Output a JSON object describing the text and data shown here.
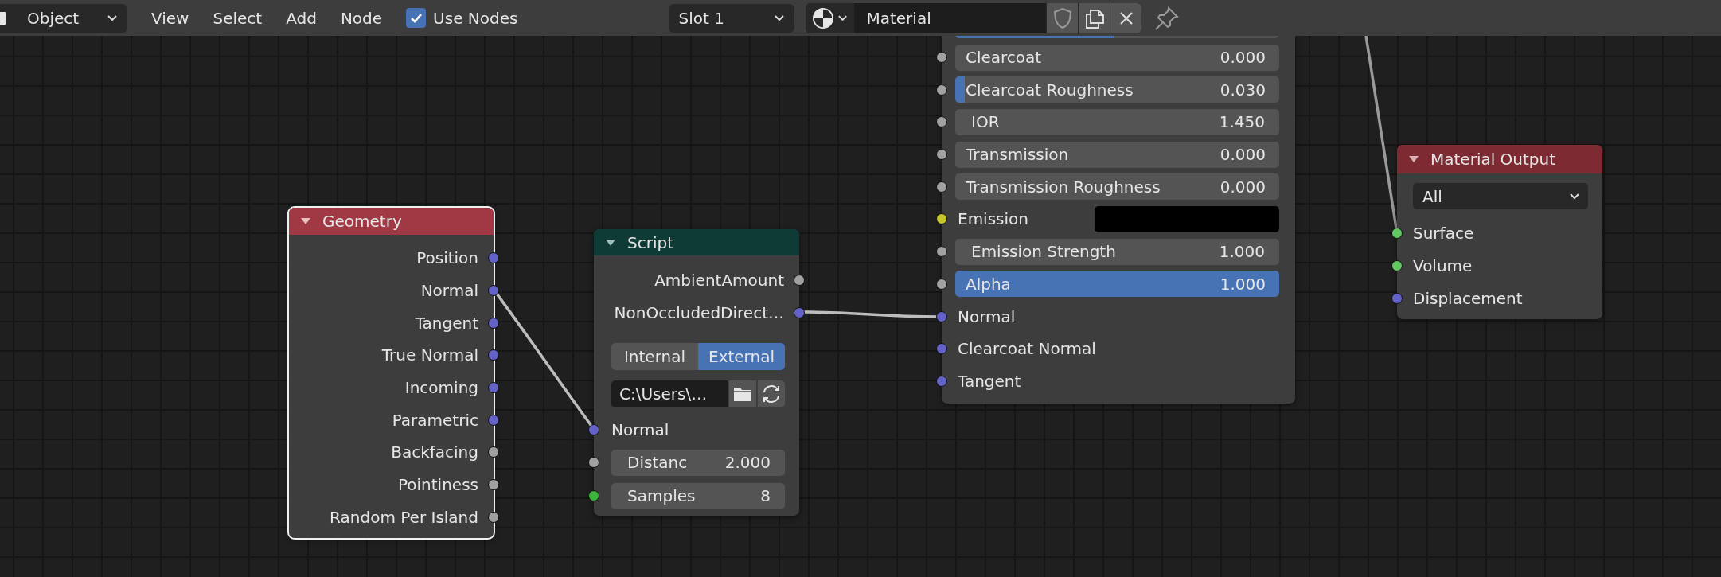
{
  "header": {
    "editor_type": "Object",
    "menus": [
      "View",
      "Select",
      "Add",
      "Node"
    ],
    "use_nodes": {
      "label": "Use Nodes",
      "checked": true
    },
    "slot": "Slot 1",
    "material": {
      "name": "Material"
    }
  },
  "geometry_node": {
    "title": "Geometry",
    "selected": true,
    "outputs": [
      {
        "label": "Position",
        "color": "#6363c7"
      },
      {
        "label": "Normal",
        "color": "#6363c7"
      },
      {
        "label": "Tangent",
        "color": "#6363c7"
      },
      {
        "label": "True Normal",
        "color": "#6363c7"
      },
      {
        "label": "Incoming",
        "color": "#6363c7"
      },
      {
        "label": "Parametric",
        "color": "#6363c7"
      },
      {
        "label": "Backfacing",
        "color": "#a1a1a1"
      },
      {
        "label": "Pointiness",
        "color": "#a1a1a1"
      },
      {
        "label": "Random Per Island",
        "color": "#a1a1a1"
      }
    ]
  },
  "script_node": {
    "title": "Script",
    "selected": false,
    "outputs": [
      {
        "label": "AmbientAmount",
        "color": "#a1a1a1"
      },
      {
        "label": "NonOccludedDirect…",
        "color": "#6363c7"
      }
    ],
    "mode_buttons": [
      {
        "label": "Internal",
        "selected": false
      },
      {
        "label": "External",
        "selected": true
      }
    ],
    "filepath": "C:\\Users\\…",
    "inputs": [
      {
        "kind": "socket",
        "label": "Normal",
        "color": "#6363c7"
      },
      {
        "kind": "number",
        "label": "Distanc",
        "value": "2.000",
        "color": "#a1a1a1"
      },
      {
        "kind": "number",
        "label": "Samples",
        "value": "8",
        "color": "#3cb33c"
      }
    ]
  },
  "principled_node": {
    "selected": false,
    "rows": [
      {
        "kind": "slider",
        "level": 0.49
      },
      {
        "kind": "slider",
        "label": "Clearcoat",
        "value": "0.000",
        "level": 0,
        "color": "#a1a1a1"
      },
      {
        "kind": "slider",
        "label": "Clearcoat Roughness",
        "value": "0.030",
        "level": 0.03,
        "color": "#a1a1a1"
      },
      {
        "kind": "number",
        "label": "IOR",
        "value": "1.450",
        "color": "#a1a1a1"
      },
      {
        "kind": "slider",
        "label": "Transmission",
        "value": "0.000",
        "level": 0,
        "color": "#a1a1a1"
      },
      {
        "kind": "slider",
        "label": "Transmission Roughness",
        "value": "0.000",
        "level": 0,
        "color": "#a1a1a1"
      },
      {
        "kind": "color",
        "label": "Emission",
        "color": "#c7c729",
        "swatch": {
          "color": "#000000"
        }
      },
      {
        "kind": "number",
        "label": "Emission Strength",
        "value": "1.000",
        "color": "#a1a1a1"
      },
      {
        "kind": "slider",
        "label": "Alpha",
        "value": "1.000",
        "level": 1,
        "color": "#a1a1a1"
      },
      {
        "kind": "socket",
        "label": "Normal",
        "color": "#6363c7"
      },
      {
        "kind": "socket",
        "label": "Clearcoat Normal",
        "color": "#6363c7"
      },
      {
        "kind": "socket",
        "label": "Tangent",
        "color": "#6363c7"
      }
    ]
  },
  "material_output_node": {
    "title": "Material Output",
    "selected": false,
    "target": "All",
    "inputs": [
      {
        "label": "Surface",
        "color": "#63c763"
      },
      {
        "label": "Volume",
        "color": "#63c763"
      },
      {
        "label": "Displacement",
        "color": "#6363c7"
      }
    ]
  }
}
